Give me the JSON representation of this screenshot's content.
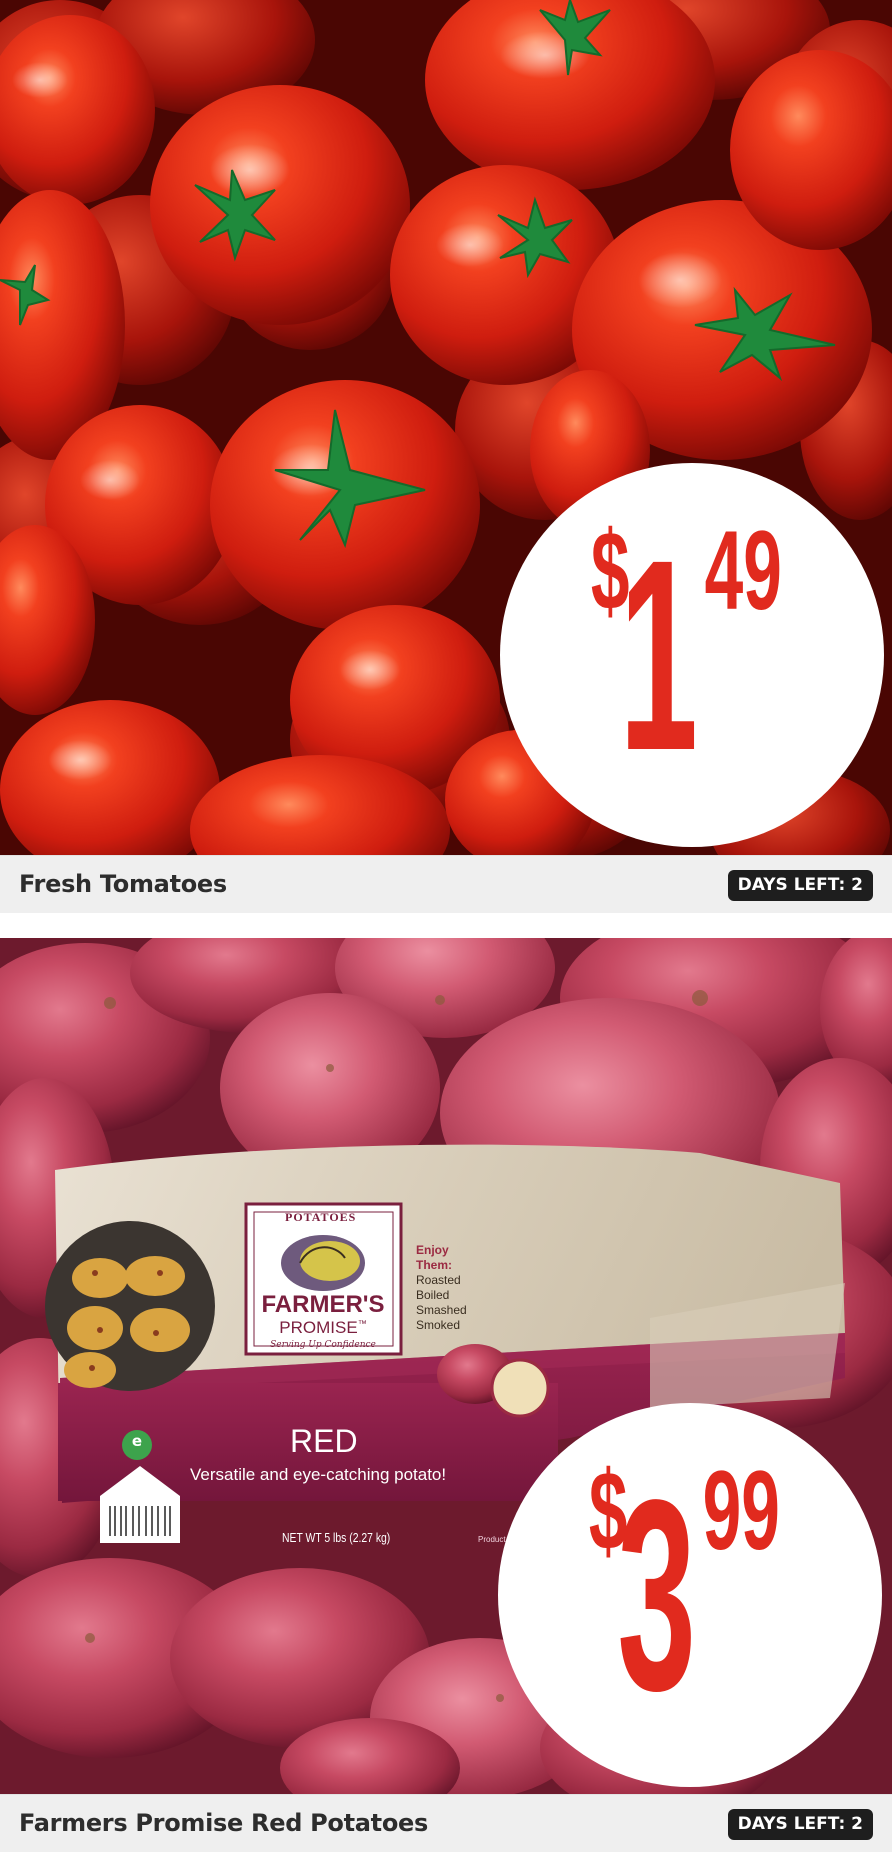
{
  "items": [
    {
      "product_name": "Fresh Tomatoes",
      "price": {
        "currency": "$",
        "dollars": "1",
        "cents": "49"
      },
      "days_left": "DAYS LEFT: 2",
      "image_subject": "tomatoes-photo"
    },
    {
      "product_name": "Farmers Promise Red Potatoes",
      "price": {
        "currency": "$",
        "dollars": "3",
        "cents": "99"
      },
      "days_left": "DAYS LEFT: 2",
      "image_subject": "red-potatoes-photo",
      "package": {
        "top_label": "POTATOES",
        "brand_line1": "FARMER'S",
        "brand_line2": "PROMISE",
        "trademark": "™",
        "tagline": "Serving Up Confidence",
        "enjoy_lines": [
          "Enjoy",
          "Them:",
          "Roasted",
          "Boiled",
          "Smashed",
          "Smoked"
        ],
        "variety": "RED",
        "description": "Versatile and eye-catching potato!",
        "net_weight": "NET WT 5 lbs (2.27 kg)",
        "product_of": "Product",
        "eco_badge": "e"
      }
    }
  ],
  "colors": {
    "price_red": "#e12a1e",
    "badge_bg": "#1e1e1e",
    "caption_bg": "#efefef",
    "package_maroon": "#8d1b45"
  }
}
